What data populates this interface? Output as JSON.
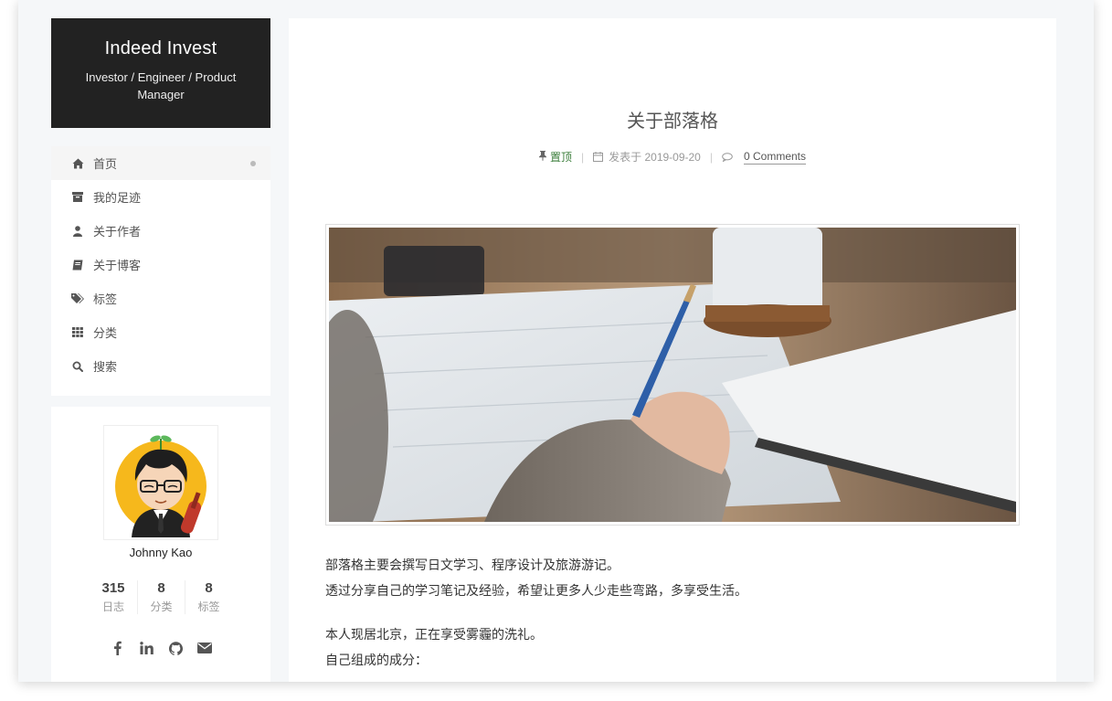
{
  "site": {
    "title": "Indeed Invest",
    "subtitle": "Investor / Engineer / Product Manager"
  },
  "menu": {
    "items": [
      {
        "label": "首页",
        "icon": "home-icon",
        "active": true
      },
      {
        "label": "我的足迹",
        "icon": "archive-icon",
        "active": false
      },
      {
        "label": "关于作者",
        "icon": "user-icon",
        "active": false
      },
      {
        "label": "关于博客",
        "icon": "book-icon",
        "active": false
      },
      {
        "label": "标签",
        "icon": "tags-icon",
        "active": false
      },
      {
        "label": "分类",
        "icon": "grid-icon",
        "active": false
      },
      {
        "label": "搜索",
        "icon": "search-icon",
        "active": false
      }
    ]
  },
  "author": {
    "name": "Johnny Kao",
    "stats": [
      {
        "num": "315",
        "label": "日志"
      },
      {
        "num": "8",
        "label": "分类"
      },
      {
        "num": "8",
        "label": "标签"
      }
    ],
    "socials": [
      "facebook-icon",
      "linkedin-icon",
      "github-icon",
      "email-icon"
    ]
  },
  "post": {
    "title": "关于部落格",
    "pinned_label": "置顶",
    "posted_prefix": "发表于",
    "date": "2019-09-20",
    "comments": "0 Comments",
    "body": [
      "部落格主要会撰写日文学习、程序设计及旅游游记。",
      "透过分享自己的学习笔记及经验，希望让更多人少走些弯路，多享受生活。",
      "本人现居北京，正在享受雾霾的洗礼。",
      "自己组成的成分："
    ]
  },
  "colors": {
    "brand_bg": "#222222",
    "page_bg": "#f5f7f9",
    "pin_green": "#3a7d3a"
  }
}
